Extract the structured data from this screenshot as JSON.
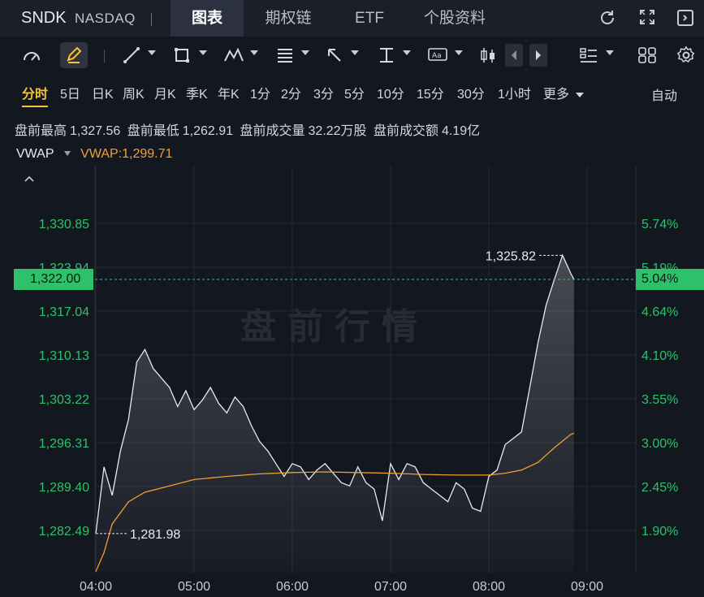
{
  "header": {
    "ticker": "SNDK",
    "exchange": "NASDAQ",
    "tabs": [
      "图表",
      "期权链",
      "ETF",
      "个股资料"
    ],
    "active_tab": "图表",
    "icons": [
      "refresh-icon",
      "fullscreen-icon",
      "sidebar-icon"
    ]
  },
  "toolbar": {
    "icons": [
      "gauge-icon",
      "pen-icon",
      "line-tool-icon",
      "rect-tool-icon",
      "pattern-tool-icon",
      "fib-tool-icon",
      "arrow-tool-icon",
      "measure-tool-icon",
      "text-tool-icon",
      "candle-type-icon",
      "prev-icon",
      "next-icon",
      "list-layout-icon",
      "grid-layout-icon",
      "settings-icon"
    ]
  },
  "periods": {
    "items": [
      "分时",
      "5日",
      "日K",
      "周K",
      "月K",
      "季K",
      "年K",
      "1分",
      "2分",
      "3分",
      "5分",
      "10分",
      "15分",
      "30分",
      "1小时",
      "更多"
    ],
    "active": "分时",
    "auto_label": "自动"
  },
  "stats": {
    "pre_high_label": "盘前最高",
    "pre_high": "1,327.56",
    "pre_low_label": "盘前最低",
    "pre_low": "1,262.91",
    "pre_volume_label": "盘前成交量",
    "pre_volume": "32.22万股",
    "pre_amount_label": "盘前成交额",
    "pre_amount": "4.19亿"
  },
  "indicator": {
    "name": "VWAP",
    "value_text": "VWAP:1,299.71",
    "color": "#f0a030"
  },
  "watermark": "盘前行情",
  "colors": {
    "up": "#2ec06a",
    "vwap": "#f0a030",
    "active": "#f5c338",
    "price_line": "#e8eaee"
  },
  "chart_data": {
    "type": "line",
    "x_ticks": [
      "04:00",
      "05:00",
      "06:00",
      "07:00",
      "08:00",
      "09:00"
    ],
    "left_ticks": [
      "1,330.85",
      "1,323.94",
      "1,317.04",
      "1,310.13",
      "1,303.22",
      "1,296.31",
      "1,289.40",
      "1,282.49"
    ],
    "right_ticks": [
      "5.74%",
      "5.19%",
      "4.64%",
      "4.10%",
      "3.55%",
      "3.00%",
      "2.45%",
      "1.90%"
    ],
    "ylim": [
      1276.0,
      1336.0
    ],
    "last_price": "1,322.00",
    "last_change": "5.04%",
    "high_label": "1,325.82",
    "low_label": "1,281.98",
    "series": [
      {
        "name": "price",
        "x": [
          "04:00",
          "04:05",
          "04:10",
          "04:15",
          "04:20",
          "04:25",
          "04:30",
          "04:35",
          "04:40",
          "04:45",
          "04:50",
          "04:55",
          "05:00",
          "05:05",
          "05:10",
          "05:15",
          "05:20",
          "05:25",
          "05:30",
          "05:35",
          "05:40",
          "05:45",
          "05:50",
          "05:55",
          "06:00",
          "06:05",
          "06:10",
          "06:15",
          "06:20",
          "06:25",
          "06:30",
          "06:35",
          "06:40",
          "06:45",
          "06:50",
          "06:55",
          "07:00",
          "07:05",
          "07:10",
          "07:15",
          "07:20",
          "07:25",
          "07:30",
          "07:35",
          "07:40",
          "07:45",
          "07:50",
          "07:55",
          "08:00",
          "08:05",
          "08:10",
          "08:15",
          "08:20",
          "08:25",
          "08:30",
          "08:35",
          "08:40",
          "08:45",
          "08:50",
          "08:52"
        ],
        "values": [
          1282.0,
          1292.5,
          1288.0,
          1295.0,
          1300.0,
          1309.0,
          1311.0,
          1308.0,
          1306.5,
          1305.0,
          1302.0,
          1304.5,
          1301.5,
          1303.0,
          1305.0,
          1302.5,
          1301.0,
          1303.5,
          1302.0,
          1299.0,
          1296.5,
          1295.0,
          1293.0,
          1291.0,
          1293.0,
          1292.5,
          1290.5,
          1292.0,
          1293.0,
          1291.5,
          1290.0,
          1289.5,
          1292.5,
          1290.0,
          1289.0,
          1284.0,
          1293.0,
          1290.5,
          1293.0,
          1292.5,
          1290.0,
          1289.0,
          1288.0,
          1287.0,
          1290.0,
          1289.0,
          1286.0,
          1285.5,
          1291.0,
          1292.0,
          1296.0,
          1297.0,
          1298.0,
          1305.0,
          1312.0,
          1318.0,
          1322.0,
          1325.82,
          1323.0,
          1322.0
        ]
      },
      {
        "name": "VWAP",
        "x": [
          "04:00",
          "04:05",
          "04:10",
          "04:20",
          "04:30",
          "04:45",
          "05:00",
          "05:20",
          "05:40",
          "06:00",
          "06:20",
          "06:40",
          "07:00",
          "07:20",
          "07:40",
          "08:00",
          "08:10",
          "08:20",
          "08:30",
          "08:40",
          "08:50",
          "08:52"
        ],
        "values": [
          1276.0,
          1279.0,
          1283.5,
          1287.0,
          1288.5,
          1289.5,
          1290.5,
          1291.0,
          1291.4,
          1291.6,
          1291.7,
          1291.6,
          1291.5,
          1291.3,
          1291.2,
          1291.2,
          1291.5,
          1292.0,
          1293.2,
          1295.5,
          1297.6,
          1297.8
        ]
      }
    ]
  }
}
